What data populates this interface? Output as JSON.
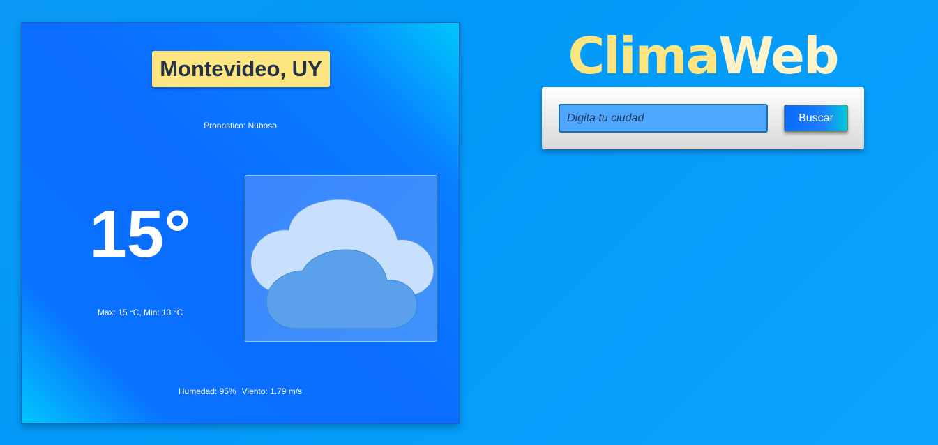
{
  "app": {
    "brand_part1": "Clima",
    "brand_part2": "Web"
  },
  "search": {
    "placeholder": "Digita tu ciudad",
    "value": "",
    "button_label": "Buscar"
  },
  "weather": {
    "city": "Montevideo, UY",
    "forecast": "Pronostico: Nuboso",
    "temperature": "15°",
    "minmax": "Max: 15 °C, Min: 13 °C",
    "humidity": "Humedad: 95%",
    "wind": "Viento: 1.79 m/s",
    "icon": "cloudy-icon"
  },
  "colors": {
    "background": "#0399f8",
    "card_blue": "#0b6cff",
    "badge_yellow": "#fde682",
    "brand_yellow": "#fde682",
    "input_blue": "#4da6ff"
  }
}
